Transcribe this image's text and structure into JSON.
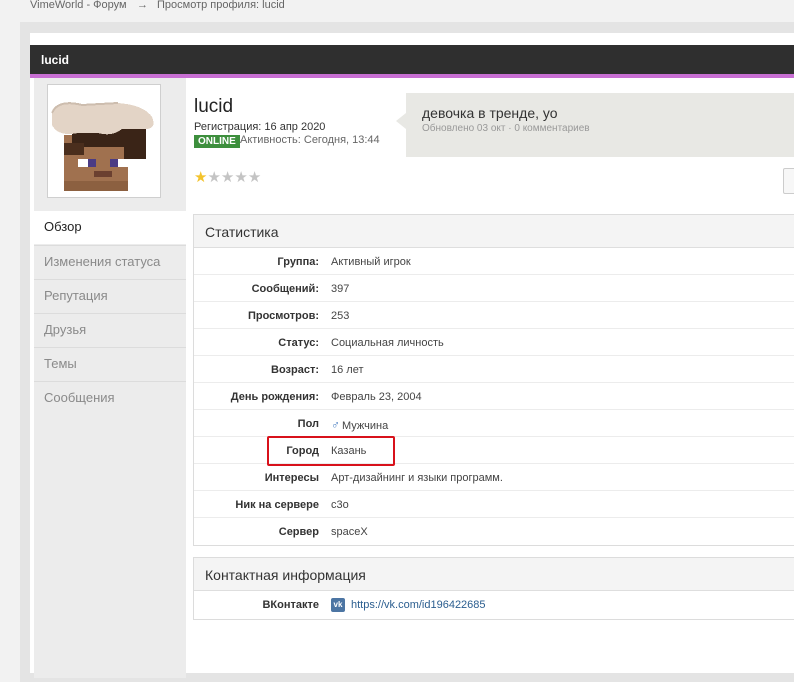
{
  "breadcrumb": {
    "home": "VimeWorld - Форум",
    "sep": "→",
    "current": "Просмотр профиля: lucid"
  },
  "profile": {
    "title": "lucid",
    "username": "lucid",
    "registration": "Регистрация: 16 апр 2020",
    "online_badge": "ONLINE",
    "activity": "Активность: Сегодня, 13:44",
    "rating": 1,
    "rating_max": 5
  },
  "status": {
    "text": "девочка в тренде, уо",
    "meta": "Обновлено 03 окт · 0 комментариев"
  },
  "nav": [
    "Обзор",
    "Изменения статуса",
    "Репутация",
    "Друзья",
    "Темы",
    "Сообщения"
  ],
  "stats": {
    "title": "Статистика",
    "rows": [
      {
        "label": "Группа:",
        "value": "Активный игрок"
      },
      {
        "label": "Сообщений:",
        "value": "397"
      },
      {
        "label": "Просмотров:",
        "value": "253"
      },
      {
        "label": "Статус:",
        "value": "Социальная личность"
      },
      {
        "label": "Возраст:",
        "value": "16 лет"
      },
      {
        "label": "День рождения:",
        "value": "Февраль 23, 2004"
      },
      {
        "label": "Пол",
        "value": "Мужчина"
      },
      {
        "label": "Город",
        "value": "Казань"
      },
      {
        "label": "Интересы",
        "value": "Арт-дизайнинг и языки программ."
      },
      {
        "label": "Ник на сервере",
        "value": "c3o"
      },
      {
        "label": "Сервер",
        "value": "spaceX"
      }
    ]
  },
  "contacts": {
    "title": "Контактная информация",
    "rows": [
      {
        "label": "ВКонтакте",
        "icon": "vk-icon",
        "value": "https://vk.com/id196422685"
      }
    ]
  },
  "colors": {
    "accent_line": "#c86fd3",
    "titlebar": "#2f2f2f",
    "online": "#3d8f3d",
    "highlight": "#d8111b",
    "vk": "#4c75a3"
  }
}
